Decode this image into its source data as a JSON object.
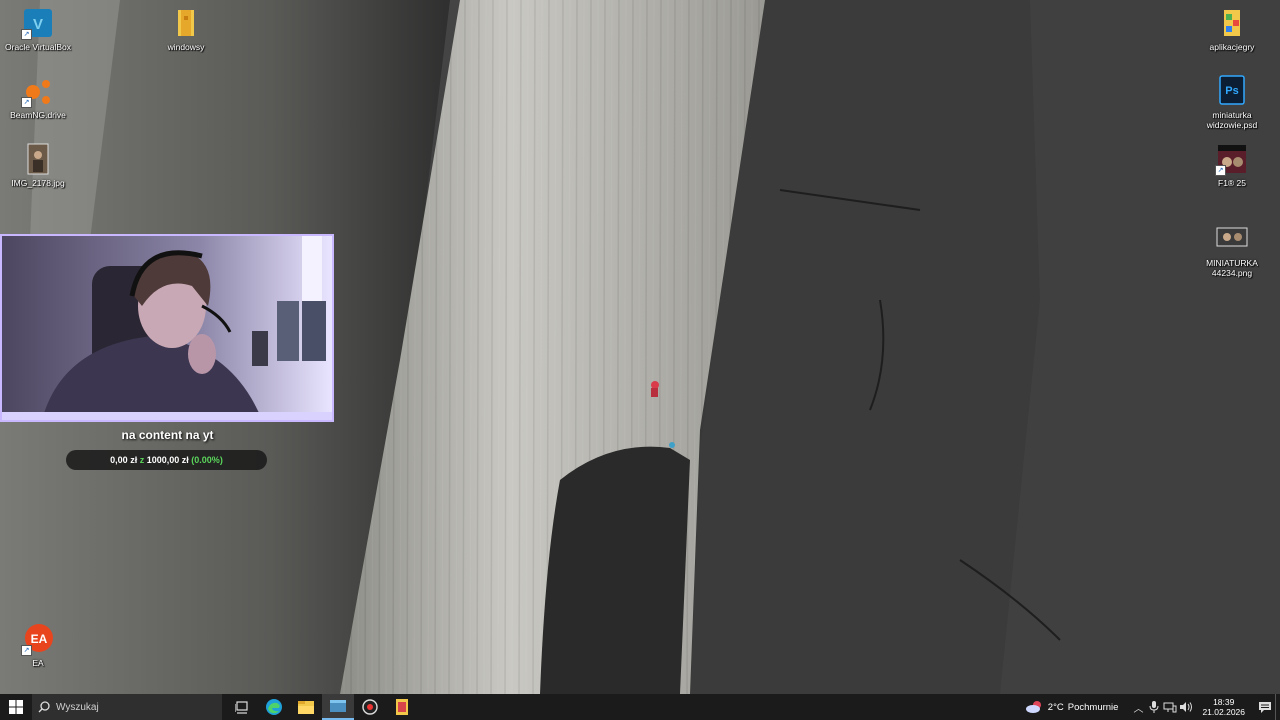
{
  "desktop_icons": {
    "virtualbox": "Oracle VirtualBox",
    "windowsy": "windowsy",
    "beamng": "BeamNG.drive",
    "img": "IMG_2178.jpg",
    "ea": "EA",
    "aplikacje": "aplikacjegry",
    "psd": "miniaturka widzowie.psd",
    "f1": "F1® 25",
    "miniaturka_png": "MINIATURKA 44234.png"
  },
  "overlay": {
    "goal_title": "na content na yt",
    "current": "0,00 zł",
    "separator": "z",
    "target": "1000,00 zł",
    "percent": "(0.00%)",
    "progress": 0.0
  },
  "taskbar": {
    "search_placeholder": "Wyszukaj",
    "weather_temp": "2°C",
    "weather_desc": "Pochmurnie",
    "time": "18:39",
    "date": "21.02.2026"
  },
  "colors": {
    "taskbar_bg": "#1b1b1b",
    "accent": "#76b9ed",
    "goal_green": "#5bd65b"
  }
}
